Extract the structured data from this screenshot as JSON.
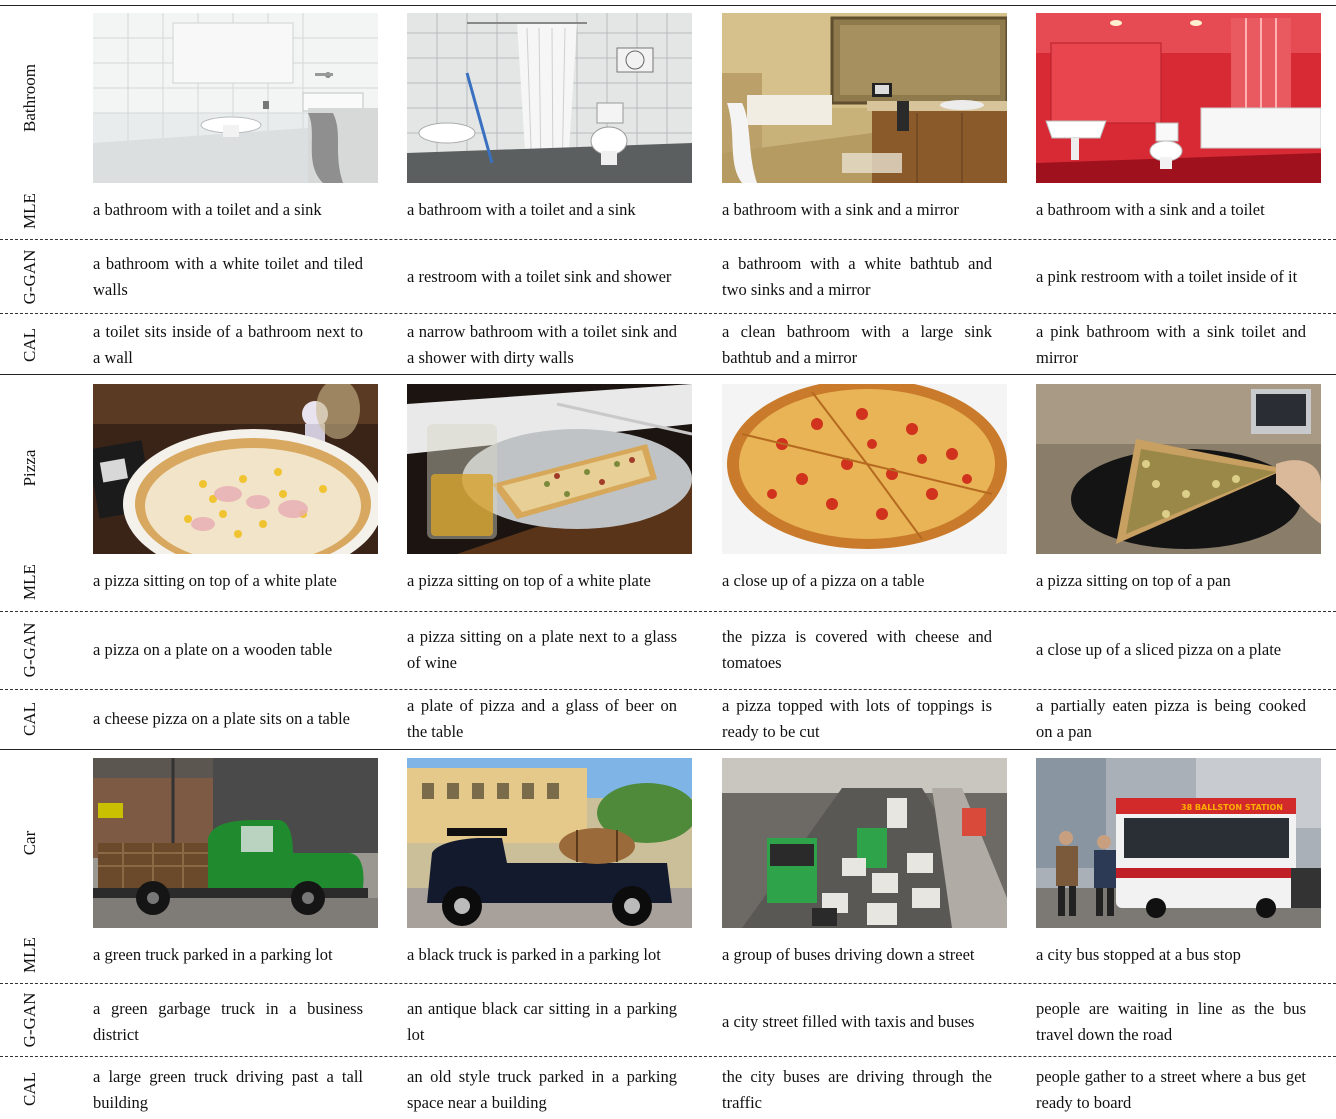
{
  "rows": [
    {
      "category": "Bathroom",
      "captions": [
        {
          "mle": "a bathroom with a toilet and a sink",
          "ggan": "a bathroom with a white toilet and tiled walls",
          "cal": "a toilet sits inside of a bathroom next to a wall"
        },
        {
          "mle": "a bathroom with a toilet and a sink",
          "ggan": "a restroom with a toilet sink and shower",
          "cal": "a narrow bathroom with a toilet sink and a shower with dirty walls"
        },
        {
          "mle": "a bathroom with a sink and a mirror",
          "ggan": "a bathroom with a white bathtub and two sinks and a mirror",
          "cal": "a clean bathroom with a large sink bathtub and a mirror"
        },
        {
          "mle": "a bathroom with a sink and a toilet",
          "ggan": "a pink restroom with a toilet inside of it",
          "cal": "a pink bathroom with a sink toilet and mirror"
        }
      ]
    },
    {
      "category": "Pizza",
      "captions": [
        {
          "mle": "a pizza sitting on top of a white plate",
          "ggan": "a pizza on a plate on a wooden table",
          "cal": "a cheese pizza on a plate sits on a table"
        },
        {
          "mle": "a pizza sitting on top of a white plate",
          "ggan": "a pizza sitting on a plate next to a glass of wine",
          "cal": "a plate of pizza and a glass of beer on the table"
        },
        {
          "mle": "a close up of a pizza on a table",
          "ggan": "the pizza is covered with cheese and tomatoes",
          "cal": "a pizza topped with lots of toppings is ready to be cut"
        },
        {
          "mle": "a pizza sitting on top of a pan",
          "ggan": "a close up of a sliced pizza on a plate",
          "cal": "a partially eaten pizza is being cooked on a pan"
        }
      ]
    },
    {
      "category": "Car",
      "captions": [
        {
          "mle": "a green truck parked in a parking lot",
          "ggan": "a green garbage truck in a business district",
          "cal": "a large green truck driving past a tall building"
        },
        {
          "mle": "a black truck is parked in a parking lot",
          "ggan": "an antique black car sitting in a parking lot",
          "cal": "an old style truck parked in a parking space near a building"
        },
        {
          "mle": "a group of buses driving down a street",
          "ggan": "a city street filled with taxis and buses",
          "cal": "the city buses are driving through the traffic"
        },
        {
          "mle": "a city bus stopped at a bus stop",
          "ggan": "people are waiting in line as the bus travel down the road",
          "cal": "people gather to a street where a bus get ready to board"
        }
      ]
    }
  ],
  "method_labels": {
    "mle": "MLE",
    "ggan": "G-GAN",
    "cal": "CAL"
  },
  "bus_sign": "38 BALLSTON STATION"
}
